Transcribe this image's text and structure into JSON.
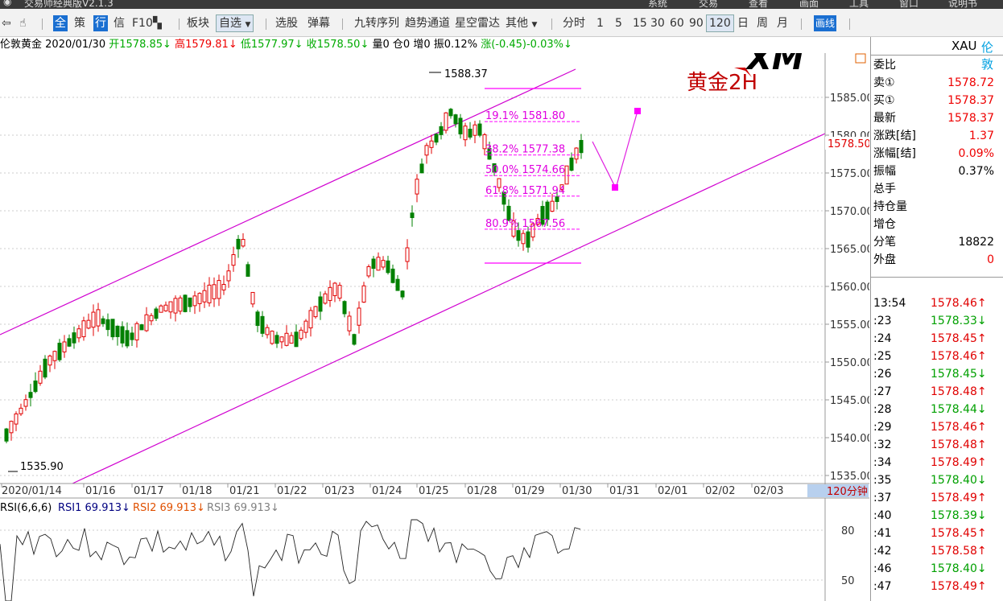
{
  "title_bar": {
    "app_title": "交易师经典版V2.1.3",
    "menus": [
      "系统",
      "交易",
      "查看",
      "画面",
      "工具",
      "窗口",
      "说明书"
    ]
  },
  "toolbar": {
    "quick": [
      "全",
      "策",
      "行",
      "信",
      "F10"
    ],
    "items": [
      "板块",
      "自选",
      "选股",
      "弹幕",
      "九转序列",
      "趋势通道",
      "星空雷达",
      "其他"
    ],
    "periods": [
      "分时",
      "1",
      "5",
      "15",
      "30",
      "60",
      "90",
      "120",
      "日",
      "周",
      "月"
    ],
    "active_period": "120",
    "draw_button": "画线"
  },
  "info_bar": {
    "symbol": "伦敦黄金",
    "date": "2020/01/30",
    "open_label": "开",
    "open": "1578.85↓",
    "high_label": "高",
    "high": "1579.81↓",
    "low_label": "低",
    "low": "1577.97↓",
    "close_label": "收",
    "close": "1578.50↓",
    "vol": "量0",
    "oi": "仓0",
    "inc": "增0",
    "amp": "振0.12%",
    "chg": "涨(-0.45)-0.03%↓"
  },
  "chart": {
    "watermark": "黄金2H",
    "logo": "XM",
    "high_label": "1588.37",
    "low_label": "1535.90",
    "current_price": "1578.50",
    "period_label": "120分钟",
    "y_ticks": [
      "1585.00",
      "1580.00",
      "1575.00",
      "1570.00",
      "1565.00",
      "1560.00",
      "1555.00",
      "1550.00",
      "1545.00",
      "1540.00",
      "1535.00"
    ],
    "x_ticks": [
      "2020/01/14",
      "01/16",
      "01/17",
      "01/18",
      "01/21",
      "01/22",
      "01/23",
      "01/24",
      "01/25",
      "01/28",
      "01/29",
      "01/30",
      "01/31",
      "02/01",
      "02/02",
      "02/03"
    ],
    "fib": [
      {
        "pct": "19.1%",
        "price": "1581.80"
      },
      {
        "pct": "38.2%",
        "price": "1577.38"
      },
      {
        "pct": "50.0%",
        "price": "1574.66"
      },
      {
        "pct": "61.8%",
        "price": "1571.94"
      },
      {
        "pct": "80.9%",
        "price": "1567.56"
      }
    ]
  },
  "rsi": {
    "title": "RSI(6,6,6)",
    "rsi1": "RSI1 69.913↓",
    "rsi2": "RSI2 69.913↓",
    "rsi3": "RSI3 69.913↓",
    "y_ticks": [
      "80",
      "50"
    ]
  },
  "quote_panel": {
    "symbol": "XAU",
    "symbol_name": "伦敦",
    "rows": [
      {
        "label": "委比",
        "value": ""
      },
      {
        "label": "卖①",
        "value": "1578.72"
      },
      {
        "label": "买①",
        "value": "1578.37"
      },
      {
        "label": "最新",
        "value": "1578.37"
      },
      {
        "label": "涨跌[结]",
        "value": "1.37"
      },
      {
        "label": "涨幅[结]",
        "value": "0.09%"
      },
      {
        "label": "振幅",
        "value": "0.37%"
      },
      {
        "label": "总手",
        "value": ""
      },
      {
        "label": "持仓量",
        "value": ""
      },
      {
        "label": "增仓",
        "value": ""
      },
      {
        "label": "分笔",
        "value": "18822"
      },
      {
        "label": "外盘",
        "value": "0"
      }
    ],
    "ticks": [
      {
        "time": "13:54",
        "price": "1578.46↑",
        "dir": "up"
      },
      {
        "time": ":23",
        "price": "1578.33↓",
        "dir": "down"
      },
      {
        "time": ":24",
        "price": "1578.45↑",
        "dir": "up"
      },
      {
        "time": ":25",
        "price": "1578.46↑",
        "dir": "up"
      },
      {
        "time": ":26",
        "price": "1578.45↓",
        "dir": "down"
      },
      {
        "time": ":27",
        "price": "1578.48↑",
        "dir": "up"
      },
      {
        "time": ":28",
        "price": "1578.44↓",
        "dir": "down"
      },
      {
        "time": ":29",
        "price": "1578.46↑",
        "dir": "up"
      },
      {
        "time": ":32",
        "price": "1578.48↑",
        "dir": "up"
      },
      {
        "time": ":34",
        "price": "1578.49↑",
        "dir": "up"
      },
      {
        "time": ":35",
        "price": "1578.40↓",
        "dir": "down"
      },
      {
        "time": ":37",
        "price": "1578.49↑",
        "dir": "up"
      },
      {
        "time": ":40",
        "price": "1578.39↓",
        "dir": "down"
      },
      {
        "time": ":41",
        "price": "1578.45↑",
        "dir": "up"
      },
      {
        "time": ":42",
        "price": "1578.58↑",
        "dir": "up"
      },
      {
        "time": ":46",
        "price": "1578.40↓",
        "dir": "down"
      },
      {
        "time": ":47",
        "price": "1578.49↑",
        "dir": "up"
      }
    ]
  },
  "colors": {
    "up": "#e00000",
    "down": "#00a000",
    "channel": "#d000d0",
    "grid": "#cccccc"
  }
}
